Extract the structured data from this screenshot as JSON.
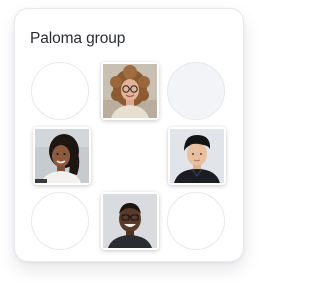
{
  "group": {
    "title": "Paloma group"
  },
  "members": [
    {
      "name": "member-woman-curly-hair-glasses",
      "bg": "#c9c1b4"
    },
    {
      "name": "member-woman-dark-hair",
      "bg": "#c7cbd0"
    },
    {
      "name": "member-man-black-hair",
      "bg": "#dfe2e6"
    },
    {
      "name": "member-man-glasses-smiling",
      "bg": "#d6d8dc"
    }
  ]
}
